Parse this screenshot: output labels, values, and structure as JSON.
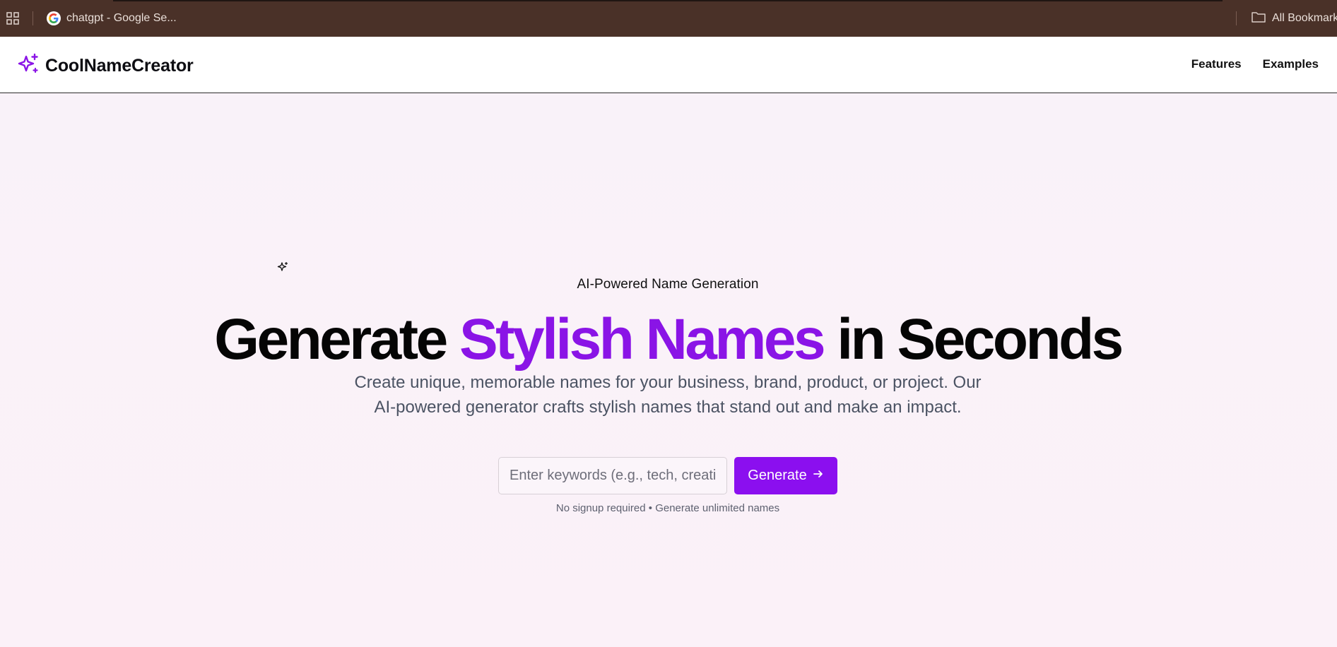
{
  "browser": {
    "bookmark_tab_label": "chatgpt - Google Se...",
    "all_bookmarks_label": "All Bookmarks",
    "bar_color": "#4a3128"
  },
  "header": {
    "brand_name": "CoolNameCreator",
    "brand_icon": "sparkles-icon",
    "nav": [
      {
        "label": "Features"
      },
      {
        "label": "Examples"
      }
    ]
  },
  "hero": {
    "eyebrow": "AI-Powered Name Generation",
    "headline_start": "Generate ",
    "headline_accent": "Stylish Names",
    "headline_end": " in Seconds",
    "subtext": "Create unique, memorable names for your business, brand, product, or project. Our AI-powered generator crafts stylish names that stand out and make an impact.",
    "input": {
      "placeholder": "Enter keywords (e.g., tech, creative...)",
      "value": ""
    },
    "generate_label": "Generate",
    "note": "No signup required • Generate unlimited names"
  },
  "colors": {
    "accent": "#8a14e6",
    "button": "#8b0fef",
    "background": "#fbf3fa"
  }
}
